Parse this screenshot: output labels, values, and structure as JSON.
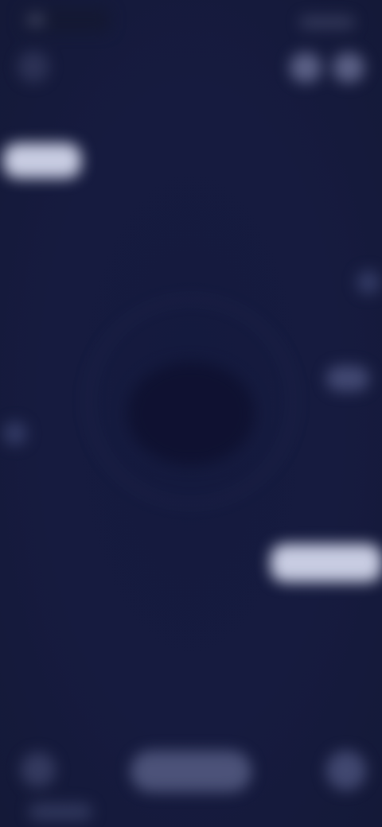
{
  "colors": {
    "background": "#151a3d",
    "chip": "#d2d6eb",
    "ring": "#3c426e"
  },
  "icons": {
    "back": "back-arrow-icon",
    "top_action_1": "share-icon",
    "top_action_2": "more-icon",
    "bottom_left": "left-action-icon",
    "bottom_right": "right-action-icon"
  }
}
